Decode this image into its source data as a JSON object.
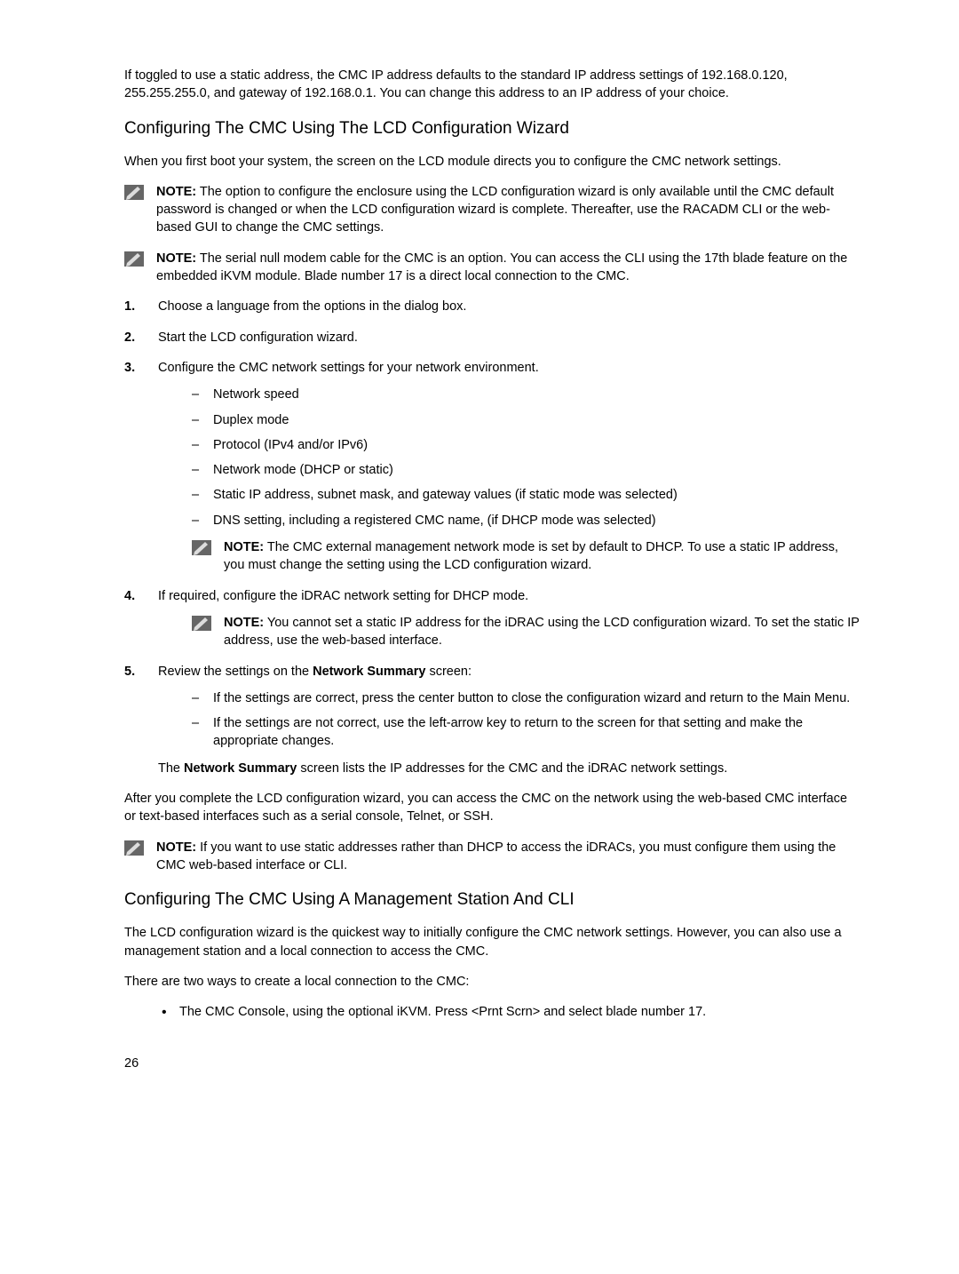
{
  "intro_para": "If toggled to use a static address, the CMC IP address defaults to the standard IP address settings of 192.168.0.120, 255.255.255.0, and gateway of 192.168.0.1. You can change this address to an IP address of your choice.",
  "section1": {
    "heading": "Configuring The CMC Using The LCD Configuration Wizard",
    "intro": "When you first boot your system, the screen on the LCD module directs you to configure the CMC network settings.",
    "note1_label": "NOTE:",
    "note1_body": " The option to configure the enclosure using the LCD configuration wizard is only available until the CMC default password is changed or when the LCD configuration wizard is complete. Thereafter, use the RACADM CLI or the web-based GUI to change the CMC settings.",
    "note2_label": "NOTE:",
    "note2_body": " The serial null modem cable for the CMC is an option. You can access the CLI using the 17th blade feature on the embedded iKVM module. Blade number 17 is a direct local connection to the CMC.",
    "step1": "Choose a language from the options in the dialog box.",
    "step2": "Start the LCD configuration wizard.",
    "step3": "Configure the CMC network settings for your network environment.",
    "s3_items": {
      "a": "Network speed",
      "b": "Duplex mode",
      "c": "Protocol (IPv4 and/or IPv6)",
      "d": "Network mode (DHCP or static)",
      "e": "Static IP address, subnet mask, and gateway values (if static mode was selected)",
      "f": "DNS setting, including a registered CMC name, (if DHCP mode was selected)"
    },
    "s3_note_label": "NOTE:",
    "s3_note_body": " The CMC external management network mode is set by default to DHCP. To use a static IP address, you must change the setting using the LCD configuration wizard.",
    "step4": "If required, configure the iDRAC network setting for DHCP mode.",
    "s4_note_label": "NOTE:",
    "s4_note_body": " You cannot set a static IP address for the iDRAC using the LCD configuration wizard. To set the static IP address, use the web-based interface.",
    "step5_pre": "Review the settings on the ",
    "step5_bold": "Network Summary",
    "step5_post": " screen:",
    "s5_items": {
      "a": "If the settings are correct, press the center button to close the configuration wizard and return to the Main Menu.",
      "b": "If the settings are not correct, use the left-arrow key to return to the screen for that setting and make the appropriate changes."
    },
    "s5_tail_pre": "The ",
    "s5_tail_bold": "Network Summary",
    "s5_tail_post": " screen lists the IP addresses for the CMC and the iDRAC network settings.",
    "closing1": "After you complete the LCD configuration wizard, you can access the CMC on the network using the web-based CMC interface or text-based interfaces such as a serial console, Telnet, or SSH.",
    "closing_note_label": "NOTE:",
    "closing_note_body": " If you want to use static addresses rather than DHCP to access the iDRACs, you must configure them using the CMC web-based interface or CLI."
  },
  "section2": {
    "heading": "Configuring The CMC Using A Management Station And CLI",
    "p1": "The LCD configuration wizard is the quickest way to initially configure the CMC network settings. However, you can also use a management station and a local connection to access the CMC.",
    "p2": "There are two ways to create a local connection to the CMC:",
    "bullet1": "The CMC Console, using the optional iKVM. Press <Prnt Scrn> and select blade number 17."
  },
  "page_number": "26"
}
